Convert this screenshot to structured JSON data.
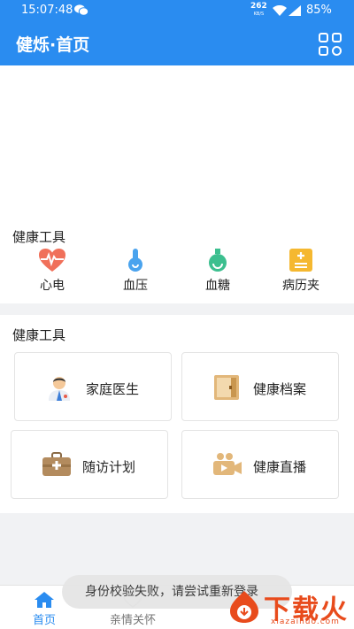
{
  "status_bar": {
    "time": "15:07:48",
    "net_speed": "262",
    "net_unit": "KB/S",
    "battery": "85%"
  },
  "app_bar": {
    "title": "健烁·首页"
  },
  "tools": {
    "title": "健康工具",
    "items": [
      {
        "label": "心电",
        "icon": "heart-ecg-icon"
      },
      {
        "label": "血压",
        "icon": "blood-pressure-icon"
      },
      {
        "label": "血糖",
        "icon": "blood-sugar-icon"
      },
      {
        "label": "病历夹",
        "icon": "medical-record-icon"
      }
    ]
  },
  "services": {
    "title": "健康工具",
    "items": [
      {
        "label": "家庭医生",
        "icon": "doctor-icon"
      },
      {
        "label": "健康档案",
        "icon": "archive-icon"
      },
      {
        "label": "随访计划",
        "icon": "medkit-icon"
      },
      {
        "label": "健康直播",
        "icon": "video-camera-icon"
      }
    ]
  },
  "toast": {
    "text": "身份校验失败，请尝试重新登录"
  },
  "tab_bar": {
    "items": [
      {
        "label": "首页",
        "active": true
      },
      {
        "label": "亲情关怀",
        "active": false
      }
    ]
  },
  "watermark": {
    "text": "下载火",
    "url": "xiazaihuo.com"
  },
  "colors": {
    "primary": "#2a8cf0",
    "watermark": "#e84b1c"
  }
}
